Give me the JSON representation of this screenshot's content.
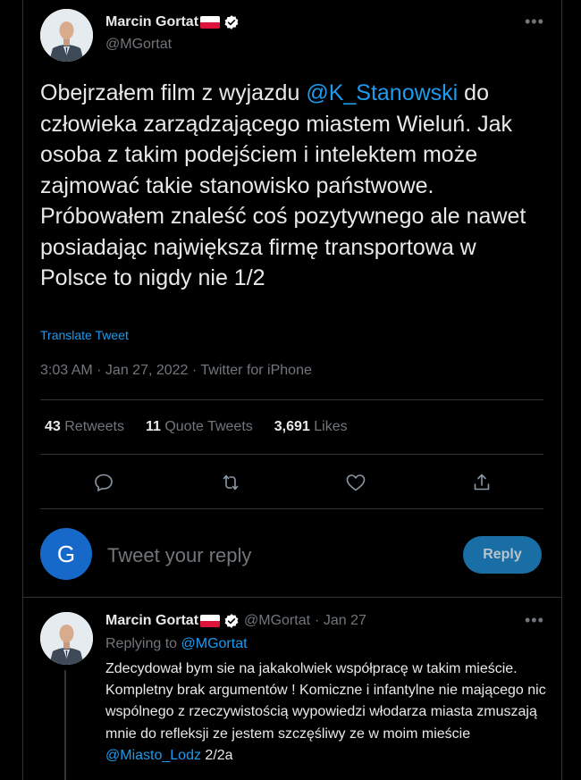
{
  "tweet": {
    "display_name": "Marcin Gortat",
    "handle": "@MGortat",
    "text_part1": "Obejrzałem film z wyjazdu ",
    "mention": "@K_Stanowski",
    "text_part2": " do człowieka zarządzającego miastem Wieluń. Jak osoba z takim podejściem i intelektem może zajmować takie stanowisko państwowe. Próbowałem znaleść coś pozytywnego ale nawet posiadając największa firmę transportowa w Polsce to nigdy nie 1/2",
    "translate_label": "Translate Tweet",
    "meta": "3:03 AM · Jan 27, 2022 · Twitter for iPhone"
  },
  "stats": [
    {
      "count": "43",
      "label": "Retweets"
    },
    {
      "count": "11",
      "label": "Quote Tweets"
    },
    {
      "count": "3,691",
      "label": "Likes"
    }
  ],
  "actions": [
    "reply-icon",
    "retweet-icon",
    "like-icon",
    "share-icon"
  ],
  "compose": {
    "avatar_letter": "G",
    "placeholder": "Tweet your reply",
    "button_label": "Reply"
  },
  "reply_tweet": {
    "display_name": "Marcin Gortat",
    "handle": "@MGortat",
    "date": "· Jan 27",
    "replying_to_label": "Replying to",
    "replying_to_handle": "@MGortat",
    "text_part1": "Zdecydował bym sie na jakakolwiek współpracę w takim mieście. Kompletny brak argumentów ! Komiczne i infantylne nie mającego nic wspólnego z rzeczywistością wypowiedzi włodarza miasta zmuszają mnie do refleksji ze jestem szczęśliwy ze w moim mieście ",
    "mention": "@Miasto_Lodz",
    "text_part2": " 2/2a"
  },
  "colors": {
    "accent": "#1d9bf0",
    "reply_button": "#1a6ea6",
    "background": "#000000",
    "flag_red": "#dc143c"
  }
}
